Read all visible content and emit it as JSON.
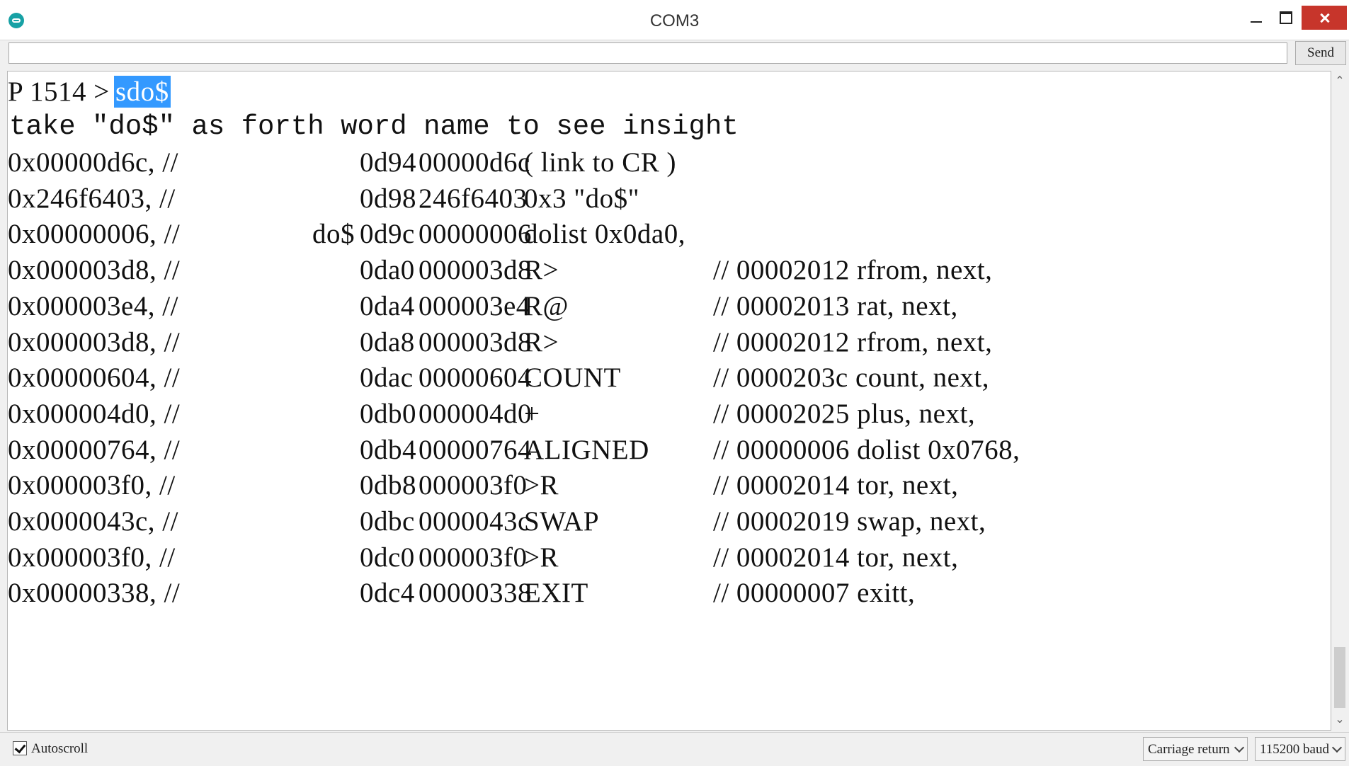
{
  "window": {
    "title": "COM3"
  },
  "send": {
    "input_value": "",
    "button_label": "Send"
  },
  "output": {
    "prompt": "P 1514 > ",
    "selected": "sdo$",
    "message": "take \"do$\" as forth word name to see insight",
    "rows": [
      {
        "hex": "0x00000d6c, //",
        "word": "",
        "addr": "0d94",
        "value": "00000d6c",
        "desc": "( link to CR )",
        "comment": ""
      },
      {
        "hex": "0x246f6403, //",
        "word": "",
        "addr": "0d98",
        "value": "246f6403",
        "desc": "0x3 \"do$\"",
        "comment": ""
      },
      {
        "hex": "0x00000006, //",
        "word": "do$",
        "addr": "0d9c",
        "value": "00000006",
        "desc": "dolist 0x0da0,",
        "comment": ""
      },
      {
        "hex": "0x000003d8, //",
        "word": "",
        "addr": "0da0",
        "value": "000003d8",
        "desc": "R>",
        "comment": "// 00002012 rfrom, next,"
      },
      {
        "hex": "0x000003e4, //",
        "word": "",
        "addr": "0da4",
        "value": "000003e4",
        "desc": "R@",
        "comment": "// 00002013 rat, next,"
      },
      {
        "hex": "0x000003d8, //",
        "word": "",
        "addr": "0da8",
        "value": "000003d8",
        "desc": "R>",
        "comment": "// 00002012 rfrom, next,"
      },
      {
        "hex": "0x00000604, //",
        "word": "",
        "addr": "0dac",
        "value": "00000604",
        "desc": "COUNT",
        "comment": "// 0000203c count, next,"
      },
      {
        "hex": "0x000004d0, //",
        "word": "",
        "addr": "0db0",
        "value": "000004d0",
        "desc": "+",
        "comment": "// 00002025 plus, next,"
      },
      {
        "hex": "0x00000764, //",
        "word": "",
        "addr": "0db4",
        "value": "00000764",
        "desc": "ALIGNED",
        "comment": "// 00000006 dolist 0x0768,"
      },
      {
        "hex": "0x000003f0, //",
        "word": "",
        "addr": "0db8",
        "value": "000003f0",
        "desc": ">R",
        "comment": "// 00002014 tor, next,"
      },
      {
        "hex": "0x0000043c, //",
        "word": "",
        "addr": "0dbc",
        "value": "0000043c",
        "desc": "SWAP",
        "comment": "// 00002019 swap, next,"
      },
      {
        "hex": "0x000003f0, //",
        "word": "",
        "addr": "0dc0",
        "value": "000003f0",
        "desc": ">R",
        "comment": "// 00002014 tor, next,"
      },
      {
        "hex": "0x00000338, //",
        "word": "",
        "addr": "0dc4",
        "value": "00000338",
        "desc": "EXIT",
        "comment": "// 00000007 exitt,"
      }
    ]
  },
  "statusbar": {
    "autoscroll_label": "Autoscroll",
    "autoscroll_checked": true,
    "line_ending": "Carriage return",
    "baud": "115200 baud"
  },
  "icons": {
    "app": "arduino-icon",
    "minimize": "minimize-icon",
    "maximize": "maximize-icon",
    "close": "close-icon"
  },
  "colors": {
    "selection": "#3399ff",
    "close_button": "#c7352b"
  }
}
